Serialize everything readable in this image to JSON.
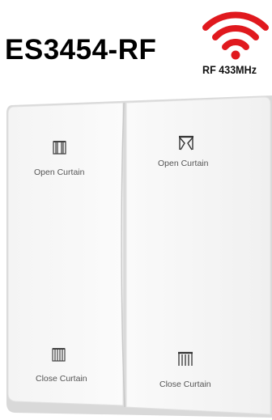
{
  "product": {
    "model": "ES3454-RF",
    "badge_label": "RF 433MHz",
    "accent_color": "#e0191e"
  },
  "buttons": {
    "left_top": {
      "label": "Open Curtain",
      "icon": "curtain-open-icon"
    },
    "right_top": {
      "label": "Open Curtain",
      "icon": "curtain-open-icon"
    },
    "left_bottom": {
      "label": "Close Curtain",
      "icon": "curtain-closed-icon"
    },
    "right_bottom": {
      "label": "Close Curtain",
      "icon": "curtain-closed-icon"
    }
  }
}
